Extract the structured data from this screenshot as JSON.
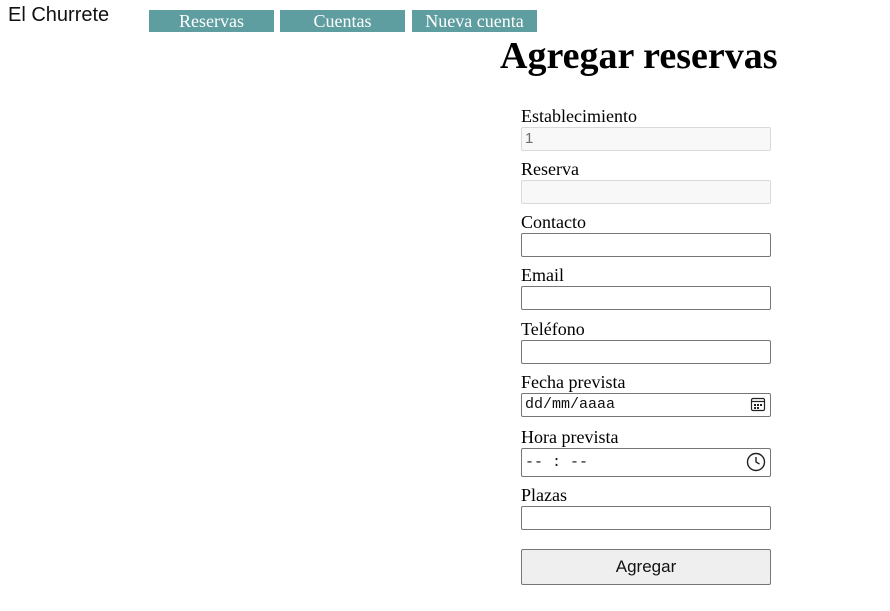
{
  "brand": "El Churrete",
  "nav": {
    "reservas": "Reservas",
    "cuentas": "Cuentas",
    "nueva_cuenta": "Nueva cuenta"
  },
  "form": {
    "title": "Agregar reservas",
    "fields": {
      "establecimiento": {
        "label": "Establecimiento",
        "value": "1"
      },
      "reserva": {
        "label": "Reserva",
        "value": ""
      },
      "contacto": {
        "label": "Contacto",
        "value": ""
      },
      "email": {
        "label": "Email",
        "value": ""
      },
      "telefono": {
        "label": "Teléfono",
        "value": ""
      },
      "fecha": {
        "label": "Fecha prevista",
        "placeholder": "dd/mm/aaaa",
        "icon": "calendar-icon"
      },
      "hora": {
        "label": "Hora prevista",
        "placeholder": "-- : --",
        "icon": "clock-icon"
      },
      "plazas": {
        "label": "Plazas",
        "value": ""
      }
    },
    "submit_label": "Agregar"
  },
  "colors": {
    "nav_background": "#5f9ea0",
    "nav_text": "#ffffff"
  }
}
